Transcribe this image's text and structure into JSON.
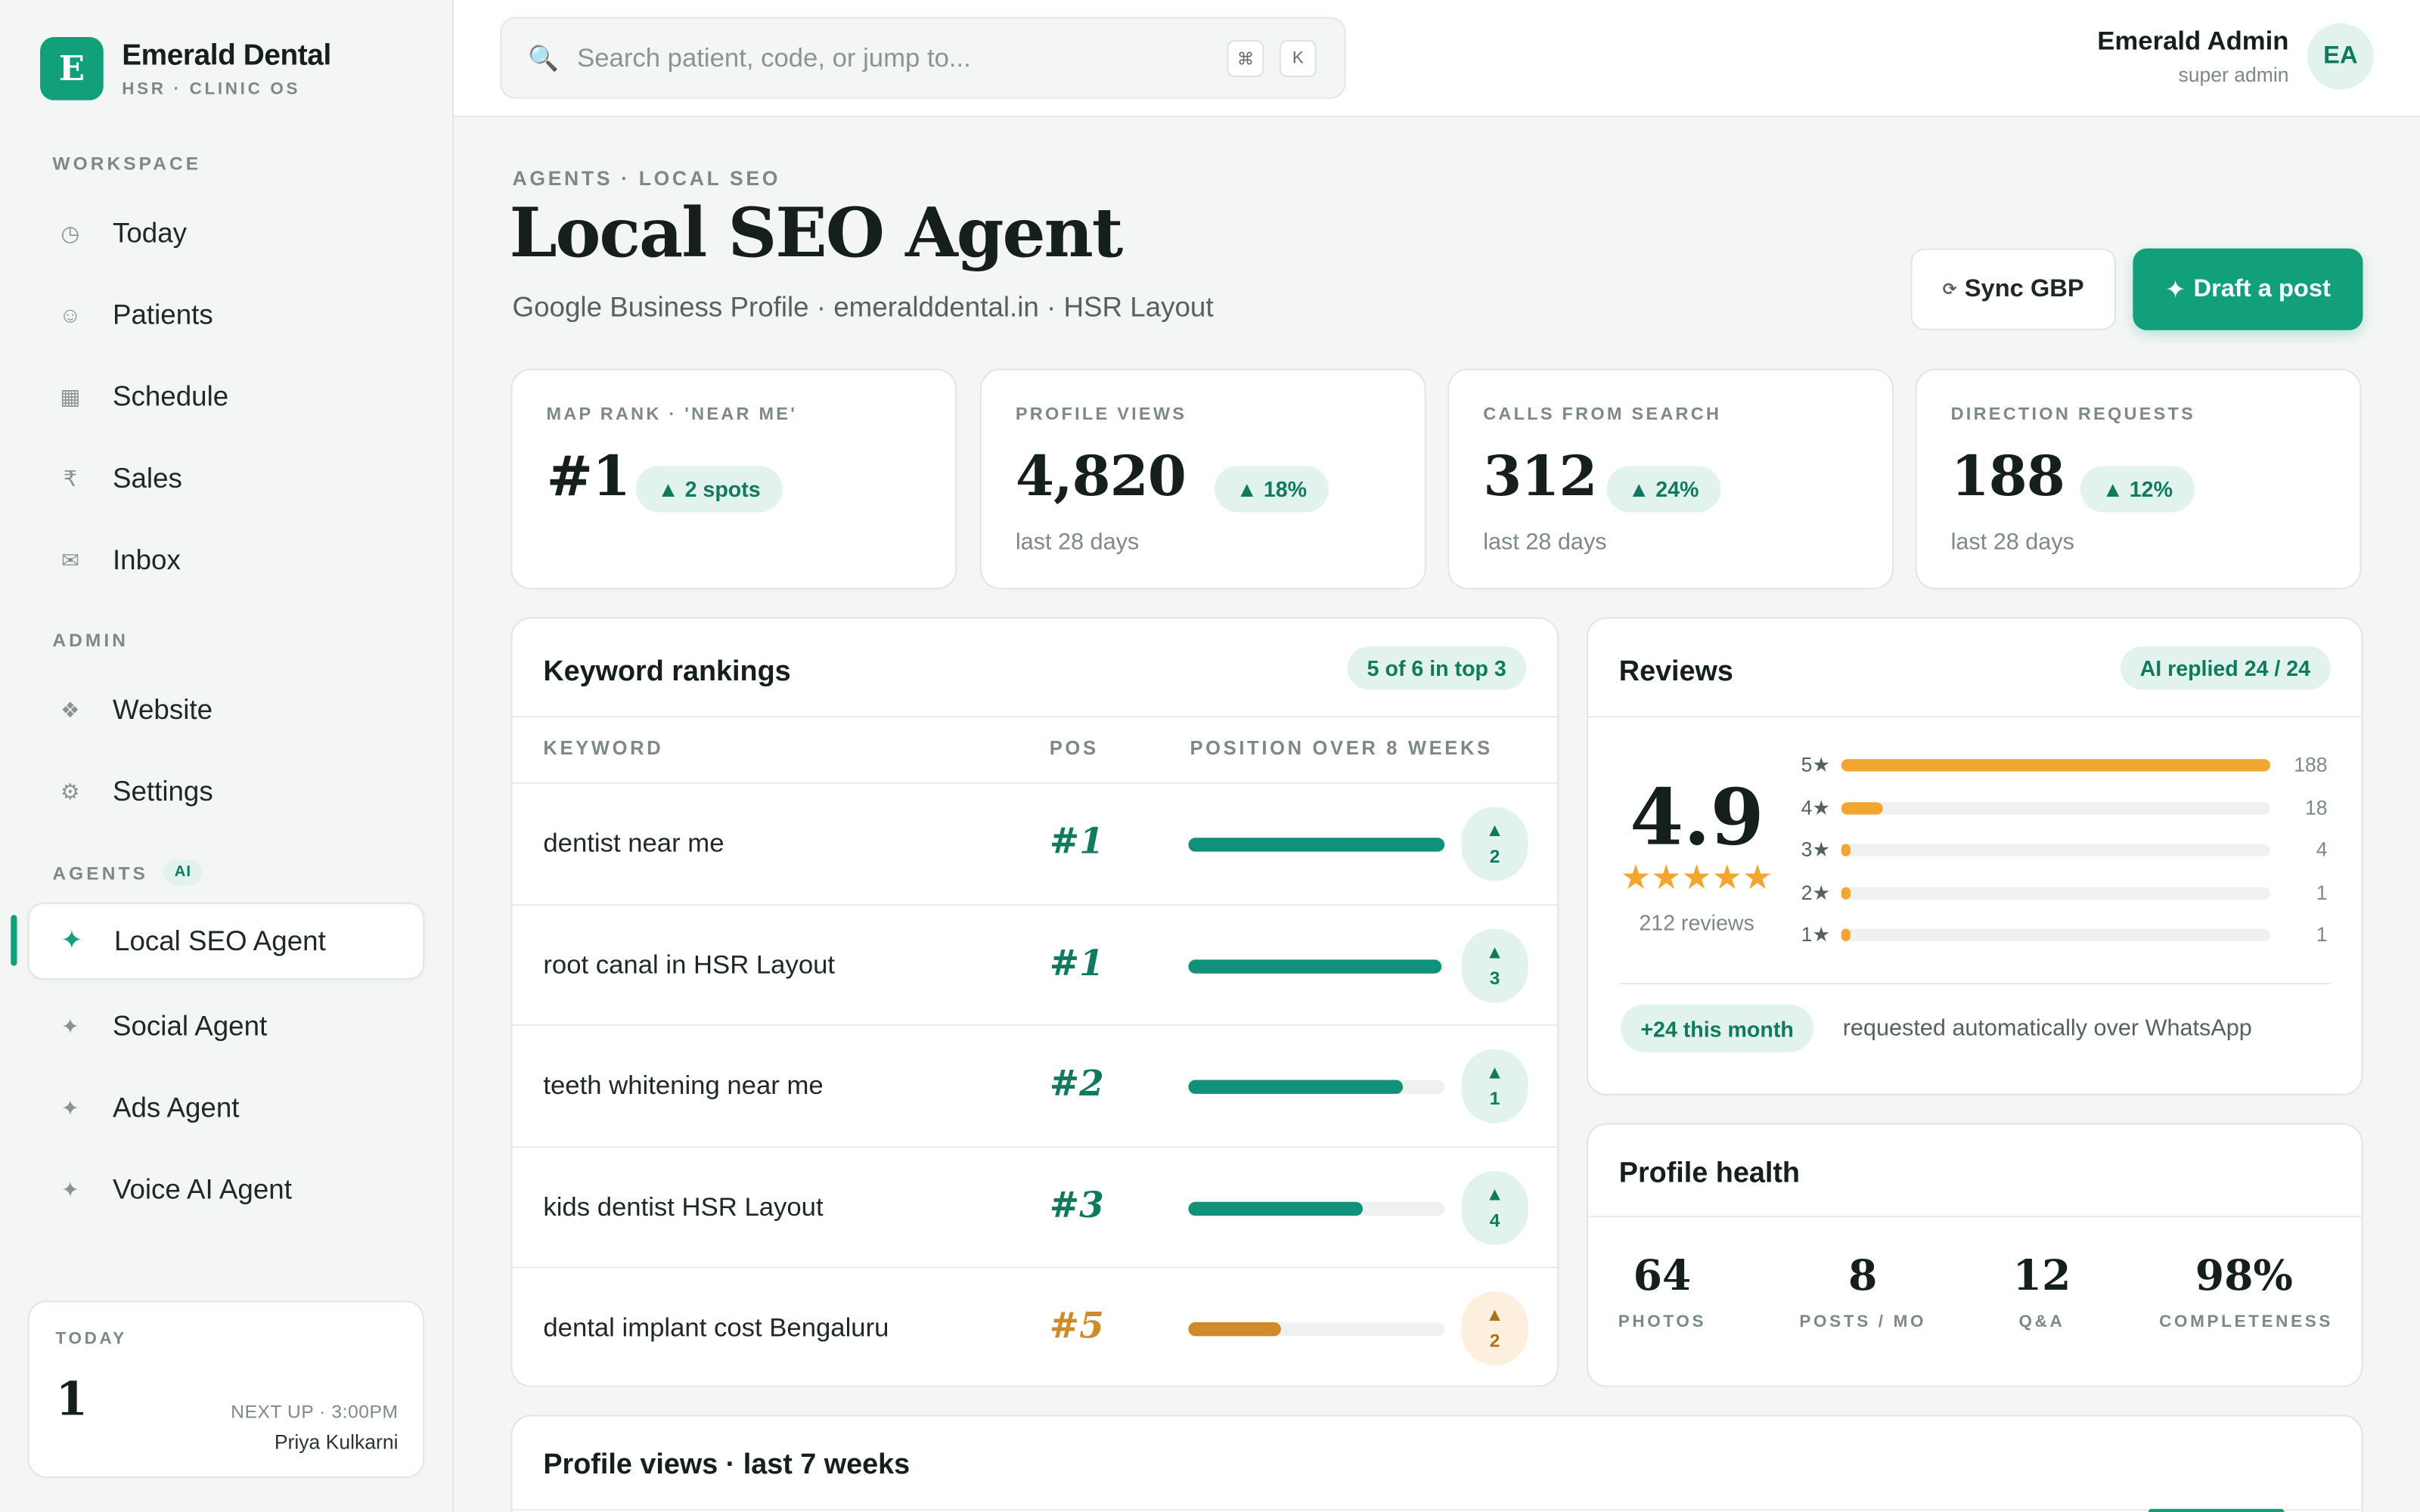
{
  "brand": {
    "logo_letter": "E",
    "name": "Emerald Dental",
    "subtitle": "HSR · CLINIC OS",
    "accent": "#12a07a"
  },
  "sidebar": {
    "workspace_label": "WORKSPACE",
    "workspace_items": [
      {
        "icon": "clock-icon",
        "label": "Today"
      },
      {
        "icon": "smiley-icon",
        "label": "Patients"
      },
      {
        "icon": "calendar-icon",
        "label": "Schedule"
      },
      {
        "icon": "rupee-icon",
        "label": "Sales"
      },
      {
        "icon": "mail-icon",
        "label": "Inbox"
      }
    ],
    "admin_label": "ADMIN",
    "admin_items": [
      {
        "icon": "diamond-icon",
        "label": "Website"
      },
      {
        "icon": "gear-icon",
        "label": "Settings"
      }
    ],
    "agents_label": "AGENTS",
    "agents_badge": "AI",
    "agent_items": [
      {
        "icon": "sparkle-icon",
        "label": "Local SEO Agent",
        "active": true
      },
      {
        "icon": "sparkle-icon",
        "label": "Social Agent"
      },
      {
        "icon": "sparkle-icon",
        "label": "Ads Agent"
      },
      {
        "icon": "sparkle-icon",
        "label": "Voice AI Agent"
      }
    ],
    "today_card": {
      "label": "TODAY",
      "count": "1",
      "next_up": "NEXT UP · 3:00PM",
      "patient": "Priya Kulkarni"
    }
  },
  "topbar": {
    "search_placeholder": "Search patient, code, or jump to...",
    "shortcut_keys": [
      "⌘",
      "K"
    ],
    "user_name": "Emerald Admin",
    "user_role": "super admin",
    "user_initials": "EA"
  },
  "header": {
    "breadcrumb": "AGENTS · LOCAL SEO",
    "title": "Local SEO Agent",
    "subtitle": "Google Business Profile · emeralddental.in · HSR Layout",
    "sync_label": "Sync GBP",
    "draft_label": "Draft a post"
  },
  "stats": [
    {
      "label": "MAP RANK · 'NEAR ME'",
      "value": "#1",
      "delta": "2 spots",
      "sub": ""
    },
    {
      "label": "PROFILE VIEWS",
      "value": "4,820",
      "delta": "18%",
      "sub": "last 28 days"
    },
    {
      "label": "CALLS FROM SEARCH",
      "value": "312",
      "delta": "24%",
      "sub": "last 28 days"
    },
    {
      "label": "DIRECTION REQUESTS",
      "value": "188",
      "delta": "12%",
      "sub": "last 28 days"
    }
  ],
  "keywords": {
    "title": "Keyword rankings",
    "badge": "5 of 6 in top 3",
    "columns": [
      "KEYWORD",
      "POS",
      "POSITION OVER 8 WEEKS"
    ],
    "rows": [
      {
        "keyword": "dentist near me",
        "pos": "#1",
        "progress": 1.0,
        "change": "2",
        "warn": false
      },
      {
        "keyword": "root canal in HSR Layout",
        "pos": "#1",
        "progress": 0.99,
        "change": "3",
        "warn": false
      },
      {
        "keyword": "teeth whitening near me",
        "pos": "#2",
        "progress": 0.84,
        "change": "1",
        "warn": false
      },
      {
        "keyword": "kids dentist HSR Layout",
        "pos": "#3",
        "progress": 0.68,
        "change": "4",
        "warn": false
      },
      {
        "keyword": "dental implant cost Bengaluru",
        "pos": "#5",
        "progress": 0.36,
        "change": "2",
        "warn": true
      }
    ]
  },
  "reviews": {
    "title": "Reviews",
    "badge": "AI replied 24 / 24",
    "rating": "4.9",
    "stars": "★★★★★",
    "count_text": "212 reviews",
    "distribution": [
      {
        "label": "5★",
        "count": "188",
        "fraction": 1.0
      },
      {
        "label": "4★",
        "count": "18",
        "fraction": 0.096
      },
      {
        "label": "3★",
        "count": "4",
        "fraction": 0.021
      },
      {
        "label": "2★",
        "count": "1",
        "fraction": 0.005
      },
      {
        "label": "1★",
        "count": "1",
        "fraction": 0.005
      }
    ],
    "month_badge": "+24 this month",
    "month_text": "requested automatically over WhatsApp"
  },
  "health": {
    "title": "Profile health",
    "items": [
      {
        "value": "64",
        "label": "PHOTOS"
      },
      {
        "value": "8",
        "label": "POSTS / MO"
      },
      {
        "value": "12",
        "label": "Q&A"
      },
      {
        "value": "98%",
        "label": "COMPLETENESS"
      }
    ]
  },
  "views_chart": {
    "title": "Profile views · last 7 weeks"
  }
}
